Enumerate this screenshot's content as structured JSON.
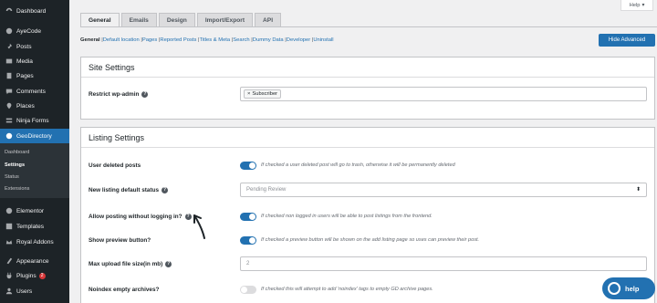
{
  "sidebar": {
    "items": [
      {
        "label": "Dashboard",
        "icon": "dashboard-icon"
      },
      {
        "label": "AyeCode",
        "icon": "ayecode-icon"
      },
      {
        "label": "Posts",
        "icon": "pin-icon"
      },
      {
        "label": "Media",
        "icon": "media-icon"
      },
      {
        "label": "Pages",
        "icon": "pages-icon"
      },
      {
        "label": "Comments",
        "icon": "comments-icon"
      },
      {
        "label": "Places",
        "icon": "places-icon"
      },
      {
        "label": "Ninja Forms",
        "icon": "ninja-forms-icon"
      },
      {
        "label": "GeoDirectory",
        "icon": "geodirectory-icon"
      },
      {
        "label": "Elementor",
        "icon": "elementor-icon"
      },
      {
        "label": "Templates",
        "icon": "templates-icon"
      },
      {
        "label": "Royal Addons",
        "icon": "royal-addons-icon"
      },
      {
        "label": "Appearance",
        "icon": "appearance-icon"
      },
      {
        "label": "Plugins",
        "icon": "plugins-icon",
        "badge": "2"
      },
      {
        "label": "Users",
        "icon": "users-icon"
      }
    ],
    "submenu": [
      "Dashboard",
      "Settings",
      "Status",
      "Extensions"
    ]
  },
  "help_button": "Help",
  "tabs": [
    "General",
    "Emails",
    "Design",
    "Import/Export",
    "API"
  ],
  "subnav": [
    "General",
    "Default location",
    "Pages",
    "Reported Posts",
    "Titles & Meta",
    "Search",
    "Dummy Data",
    "Developer",
    "Uninstall"
  ],
  "hide_advanced": "Hide Advanced",
  "site_settings": {
    "title": "Site Settings",
    "restrict_label": "Restrict wp-admin",
    "restrict_tag": "Subscriber"
  },
  "listing_settings": {
    "title": "Listing Settings",
    "rows": [
      {
        "label": "User deleted posts",
        "desc": "If checked a user deleted post will go to trash, otherwise it will be permanently deleted"
      },
      {
        "label": "New listing default status",
        "value": "Pending Review"
      },
      {
        "label": "Allow posting without logging in?",
        "desc": "If checked non logged in users will be able to post listings from the frontend."
      },
      {
        "label": "Show preview button?",
        "desc": "If checked a preview button will be shown on the add listing page so uses can preview their post."
      },
      {
        "label": "Max upload file size(in mb)",
        "value": "2"
      },
      {
        "label": "Noindex empty archives?",
        "desc": "If checked this will attempt to add 'noindex' tags to empty GD archive pages."
      }
    ]
  },
  "chat_button": "help",
  "colors": {
    "accent": "#2271b1",
    "sidebar": "#1d2327",
    "badge": "#d63638"
  }
}
